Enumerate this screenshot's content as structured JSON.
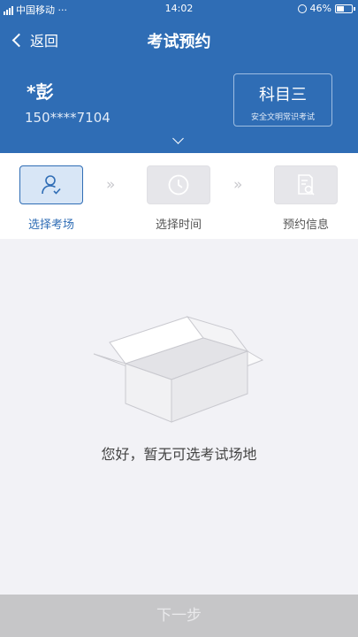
{
  "status_bar": {
    "carrier": "中国移动 ···",
    "time": "14:02",
    "battery": "46%"
  },
  "nav": {
    "back_label": "返回",
    "title": "考试预约"
  },
  "user": {
    "name": "*彭",
    "phone": "150****7104"
  },
  "subject": {
    "title": "科目三",
    "subtitle": "安全文明常识考试"
  },
  "steps": [
    {
      "label": "选择考场",
      "icon": "user-check-icon",
      "active": true
    },
    {
      "label": "选择时间",
      "icon": "clock-icon",
      "active": false
    },
    {
      "label": "预约信息",
      "icon": "document-search-icon",
      "active": false
    }
  ],
  "step_separator": "»",
  "empty_state": {
    "icon": "empty-box-icon",
    "text": "您好，暂无可选考试场地"
  },
  "footer": {
    "next_label": "下一步"
  },
  "colors": {
    "primary": "#2f6db5",
    "disabled_button": "#c6c6c8",
    "background": "#f2f2f6"
  }
}
